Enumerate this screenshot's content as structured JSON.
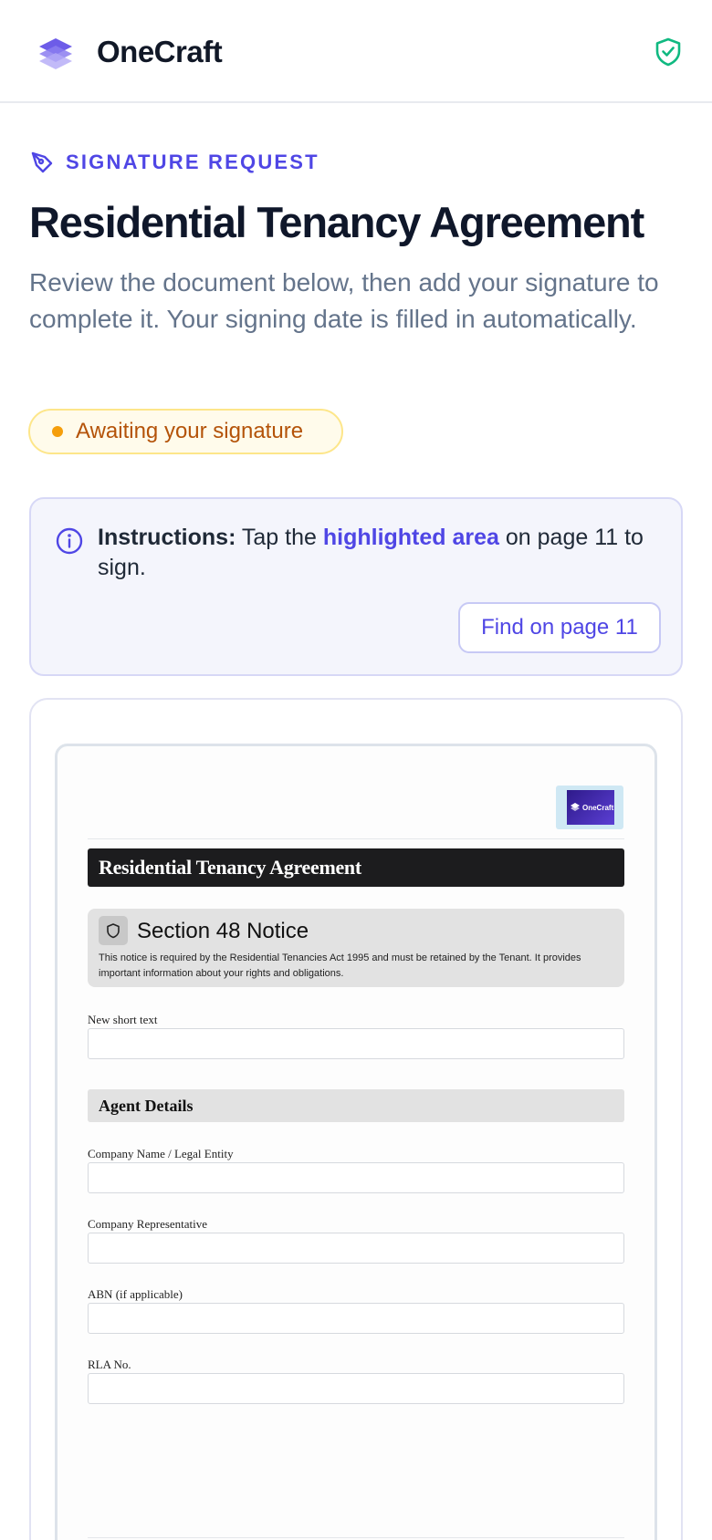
{
  "app": {
    "name": "OneCraft"
  },
  "header": {
    "security_icon": "shield-check-icon"
  },
  "request": {
    "eyebrow": "SIGNATURE REQUEST",
    "title": "Residential Tenancy Agreement",
    "subtitle": "Review the document below, then add your signature to complete it. Your signing date is filled in automatically.",
    "status": "Awaiting your signature",
    "status_color": "#f59e0b"
  },
  "instructions": {
    "lead": "Instructions:",
    "text_before": " Tap the ",
    "highlight": "highlighted area",
    "text_after": " on page 11 to sign.",
    "button_label": "Find on page 11"
  },
  "document": {
    "logo_text": "OneCraft",
    "title": "Residential Tenancy Agreement",
    "notice": {
      "title": "Section 48 Notice",
      "body": "This notice is required by the Residential Tenancies Act 1995 and must be retained by the Tenant. It provides important information about your rights and obligations."
    },
    "fields": [
      {
        "label": "New short text",
        "value": ""
      }
    ],
    "agent_section": {
      "title": "Agent Details",
      "fields": [
        {
          "label": "Company Name / Legal Entity",
          "value": ""
        },
        {
          "label": "Company Representative",
          "value": ""
        },
        {
          "label": "ABN (if applicable)",
          "value": ""
        },
        {
          "label": "RLA No.",
          "value": ""
        }
      ]
    }
  },
  "colors": {
    "accent": "#4f46e5",
    "status_text": "#b45309",
    "status_bg": "#fffbeb",
    "shield": "#10b981"
  }
}
